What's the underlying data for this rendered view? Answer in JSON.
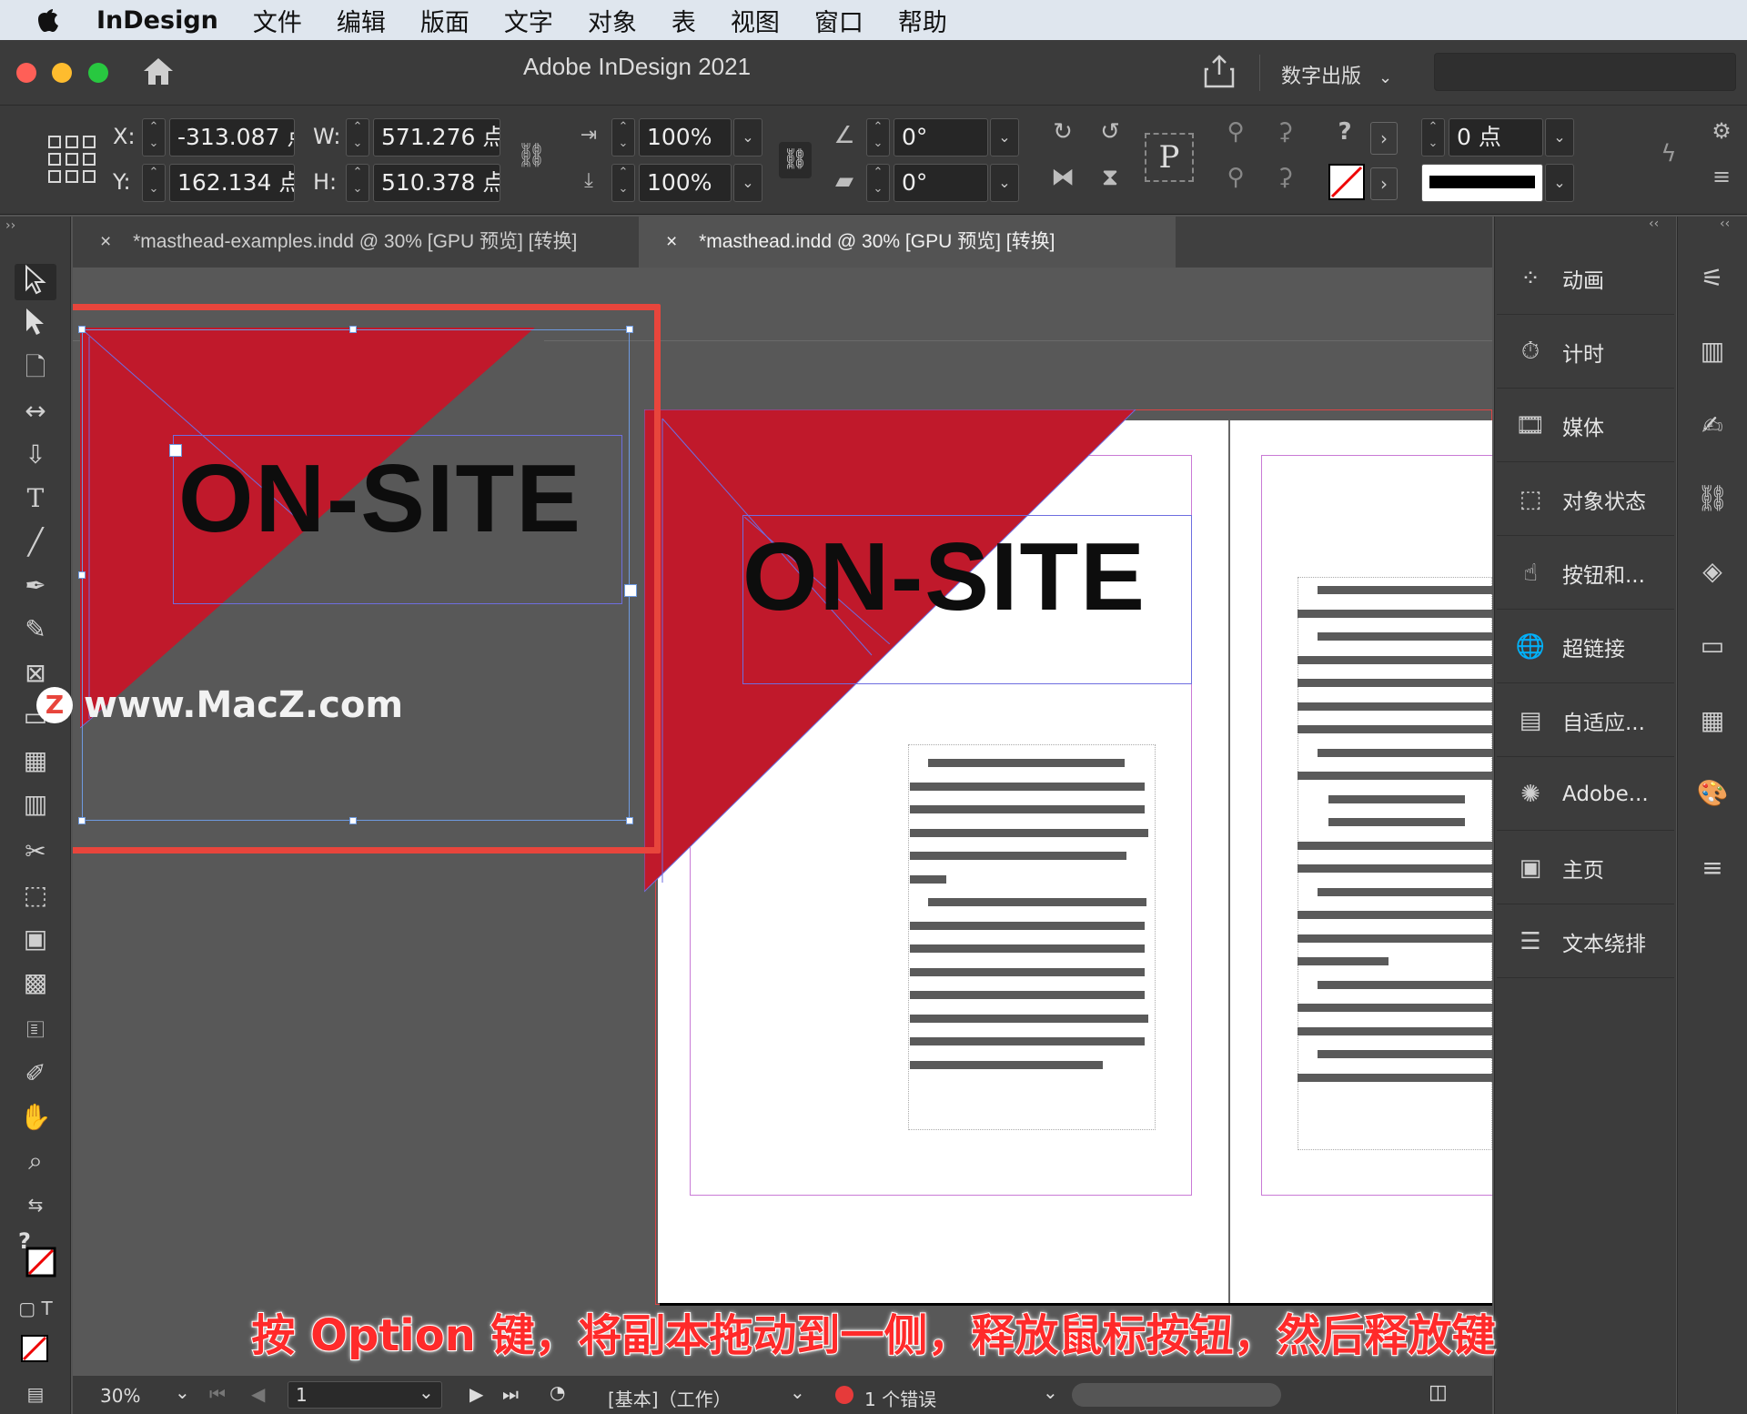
{
  "menubar": {
    "app_name": "InDesign",
    "items": [
      "文件",
      "编辑",
      "版面",
      "文字",
      "对象",
      "表",
      "视图",
      "窗口",
      "帮助"
    ]
  },
  "window": {
    "title": "Adobe InDesign 2021",
    "workspace": "数字出版",
    "search_placeholder": ""
  },
  "control": {
    "x_label": "X:",
    "x_value": "-313.087 点",
    "y_label": "Y:",
    "y_value": "162.134 点",
    "w_label": "W:",
    "w_value": "571.276 点",
    "h_label": "H:",
    "h_value": "510.378 点",
    "scale_x": "100%",
    "scale_y": "100%",
    "rotate": "0°",
    "shear": "0°",
    "stroke_weight": "0 点"
  },
  "tabs": [
    {
      "label": "*masthead-examples.indd @ 30% [GPU 预览] [转换]",
      "close": "×"
    },
    {
      "label": "*masthead.indd @ 30% [GPU 预览] [转换]",
      "close": "×"
    }
  ],
  "panels": [
    {
      "label": "动画",
      "icon": "animation-icon"
    },
    {
      "label": "计时",
      "icon": "timer-icon"
    },
    {
      "label": "媒体",
      "icon": "media-icon"
    },
    {
      "label": "对象状态",
      "icon": "object-states-icon"
    },
    {
      "label": "按钮和...",
      "icon": "buttons-icon"
    },
    {
      "label": "超链接",
      "icon": "hyperlinks-icon"
    },
    {
      "label": "自适应...",
      "icon": "liquid-layout-icon"
    },
    {
      "label": "Adobe...",
      "icon": "adobe-color-icon"
    },
    {
      "label": "主页",
      "icon": "pages-icon"
    },
    {
      "label": "文本绕排",
      "icon": "text-wrap-icon"
    }
  ],
  "canvas": {
    "headline": "ON-SITE",
    "headline_copy": "ON-SITE",
    "accent_color": "#c0192b",
    "highlight_color": "#e8453c"
  },
  "status": {
    "zoom": "30%",
    "page": "1",
    "profile": "[基本]（工作）",
    "errors": "1 个错误"
  },
  "watermark": {
    "logo_letter": "Z",
    "text": "www.MacZ.com"
  },
  "caption": "按 Option 键，将副本拖动到一侧，释放鼠标按钮，然后释放键"
}
